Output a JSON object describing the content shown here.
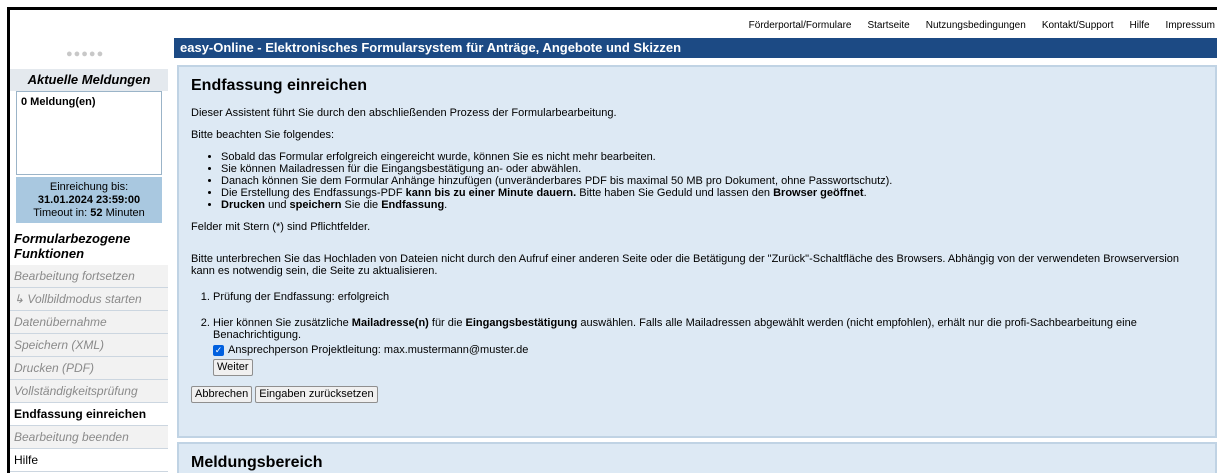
{
  "topnav": {
    "links": [
      "Förderportal/Formulare",
      "Startseite",
      "Nutzungsbedingungen",
      "Kontakt/Support",
      "Hilfe",
      "Impressum"
    ]
  },
  "logo": {
    "text": "●●●●●"
  },
  "banner": {
    "title": "easy-Online - Elektronisches Formularsystem für Anträge, Angebote und Skizzen"
  },
  "sidebar": {
    "news_heading": "Aktuelle Meldungen",
    "news_count": "0 Meldung(en)",
    "deadline_label": "Einreichung bis:",
    "deadline_value": "31.01.2024 23:59:00",
    "timeout_prefix": "Timeout in: ",
    "timeout_value": "52",
    "timeout_suffix": " Minuten",
    "functions_heading": "Formularbezogene Funktionen",
    "items": [
      {
        "label": "Bearbeitung fortsetzen"
      },
      {
        "label": "↳ Vollbildmodus starten"
      },
      {
        "label": "Datenübernahme"
      },
      {
        "label": "Speichern (XML)"
      },
      {
        "label": "Drucken (PDF)"
      },
      {
        "label": "Vollständigkeitsprüfung"
      },
      {
        "label": "Endfassung einreichen"
      },
      {
        "label": "Bearbeitung beenden"
      },
      {
        "label": "Hilfe"
      }
    ]
  },
  "main": {
    "title": "Endfassung einreichen",
    "intro": "Dieser Assistent führt Sie durch den abschließenden Prozess der Formularbearbeitung.",
    "note": "Bitte beachten Sie folgendes:",
    "bullets": {
      "b1": "Sobald das Formular erfolgreich eingereicht wurde, können Sie es nicht mehr bearbeiten.",
      "b2": "Sie können Mailadressen für die Eingangsbestätigung an- oder abwählen.",
      "b3": "Danach können Sie dem Formular Anhänge hinzufügen (unveränderbares PDF bis maximal 50 MB pro Dokument, ohne Passwortschutz).",
      "b4_a": "Die Erstellung des Endfassungs-PDF ",
      "b4_b": "kann bis zu einer Minute dauern.",
      "b4_c": " Bitte haben Sie Geduld und lassen den ",
      "b4_d": "Browser geöffnet",
      "b4_e": ".",
      "b5_a": "Drucken",
      "b5_b": " und ",
      "b5_c": "speichern",
      "b5_d": " Sie die ",
      "b5_e": "Endfassung",
      "b5_f": "."
    },
    "required_note": "Felder mit Stern (*) sind Pflichtfelder.",
    "warning": "Bitte unterbrechen Sie das Hochladen von Dateien nicht durch den Aufruf einer anderen Seite oder die Betätigung der \"Zurück\"-Schaltfläche des Browsers. Abhängig von der verwendeten Browserversion kann es notwendig sein, die Seite zu aktualisieren.",
    "step1": "Prüfung der Endfassung: erfolgreich",
    "step2_a": "Hier können Sie zusätzliche ",
    "step2_b": "Mailadresse(n)",
    "step2_c": " für die ",
    "step2_d": "Eingangsbestätigung",
    "step2_e": " auswählen. Falls alle Mailadressen abgewählt werden (nicht empfohlen), erhält nur die profi-Sachbearbeitung eine Benachrichtigung.",
    "checkbox_label": "Ansprechperson Projektleitung: max.mustermann@muster.de",
    "checkbox_checked": true,
    "next_button": "Weiter",
    "cancel_button": "Abbrechen",
    "reset_button": "Eingaben zurücksetzen"
  },
  "messages_panel": {
    "title": "Meldungsbereich"
  }
}
